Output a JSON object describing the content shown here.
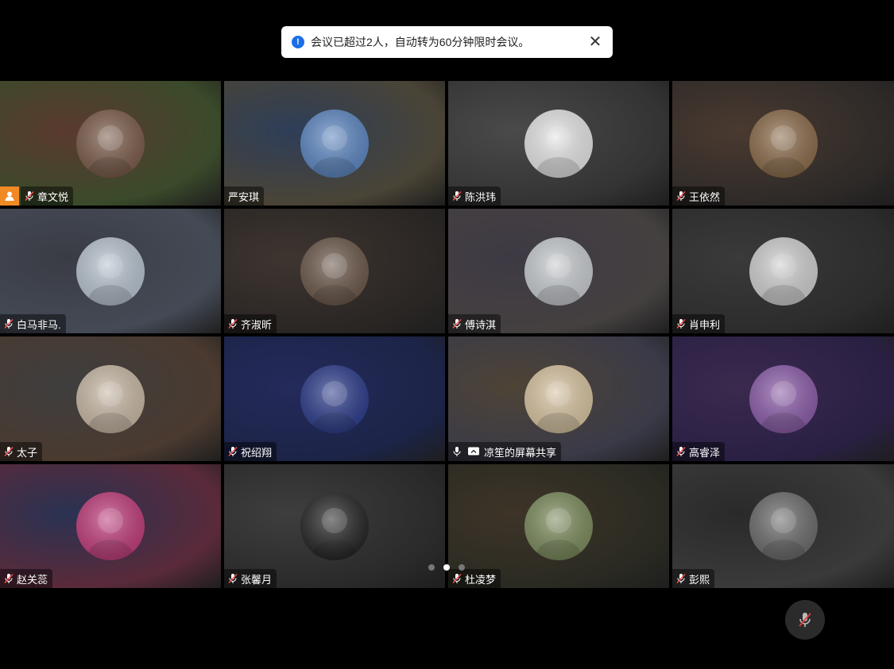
{
  "notification": {
    "message": "会议已超过2人，自动转为60分钟限时会议。",
    "info_icon": "info-icon",
    "close_icon": "close-icon"
  },
  "participants": [
    {
      "name": "章文悦",
      "muted": true,
      "host": true,
      "bg": "#5a3a2e",
      "bg2": "#3a4a2a",
      "avatar": "#7a5a48"
    },
    {
      "name": "严安琪",
      "muted": false,
      "host": false,
      "bg": "#2e3e58",
      "bg2": "#4a4436",
      "avatar": "#5b86c2"
    },
    {
      "name": "陈洪玮",
      "muted": true,
      "host": false,
      "bg": "#4a4a4a",
      "bg2": "#333333",
      "avatar": "#e6e6e6"
    },
    {
      "name": "王依然",
      "muted": true,
      "host": false,
      "bg": "#4a3a30",
      "bg2": "#2e2a28",
      "avatar": "#8a6a48"
    },
    {
      "name": "白马非马.",
      "muted": true,
      "host": false,
      "bg": "#3a3c44",
      "bg2": "#444a55",
      "avatar": "#b8c4d0"
    },
    {
      "name": "齐淑昕",
      "muted": true,
      "host": false,
      "bg": "#3e3530",
      "bg2": "#2a2624",
      "avatar": "#6a5648"
    },
    {
      "name": "傅诗淇",
      "muted": true,
      "host": false,
      "bg": "#3e3a44",
      "bg2": "#444040",
      "avatar": "#c8ccd0"
    },
    {
      "name": "肖申利",
      "muted": true,
      "host": false,
      "bg": "#3a3a3a",
      "bg2": "#2c2c2c",
      "avatar": "#cfcfcf"
    },
    {
      "name": "太子",
      "muted": true,
      "host": false,
      "bg": "#3e3e3e",
      "bg2": "#4a3a30",
      "avatar": "#c8b8a4"
    },
    {
      "name": "祝绍翔",
      "muted": true,
      "host": false,
      "bg": "#242a5a",
      "bg2": "#1c2448",
      "avatar": "#2a3a8a"
    },
    {
      "name": "凉笙的屏幕共享",
      "muted": false,
      "sharing": true,
      "host": false,
      "bg": "#4e4436",
      "bg2": "#3a3a48",
      "avatar": "#d8c4a0"
    },
    {
      "name": "高睿泽",
      "muted": true,
      "host": false,
      "bg": "#3a2a4e",
      "bg2": "#2a2044",
      "avatar": "#8a5aa8"
    },
    {
      "name": "赵关蕊",
      "muted": true,
      "host": false,
      "bg": "#2a3252",
      "bg2": "#5a2a3a",
      "avatar": "#c03a7a"
    },
    {
      "name": "张馨月",
      "muted": true,
      "host": false,
      "bg": "#3e3e3e",
      "bg2": "#2a2a2a",
      "avatar": "#222222"
    },
    {
      "name": "杜凌梦",
      "muted": true,
      "host": false,
      "bg": "#3e3428",
      "bg2": "#2a2a22",
      "avatar": "#7a8a5a"
    },
    {
      "name": "彭熙",
      "muted": true,
      "host": false,
      "bg": "#2a2a2a",
      "bg2": "#3a3a3a",
      "avatar": "#6a6a6a"
    }
  ],
  "pagination": {
    "pages": 3,
    "current": 2
  },
  "controls": {
    "floating_mic": "mic-muted-icon"
  }
}
